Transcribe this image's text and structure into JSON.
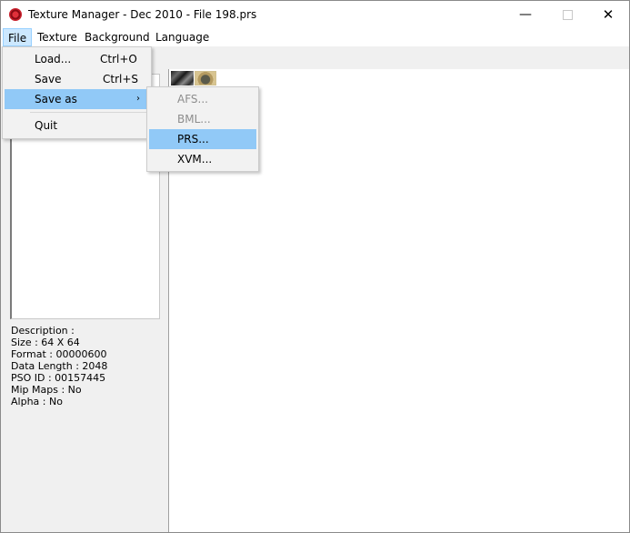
{
  "window": {
    "title": "Texture Manager - Dec 2010 - File 198.prs",
    "minimize": "—",
    "close": "✕"
  },
  "menubar": {
    "items": [
      {
        "label": "File"
      },
      {
        "label": "Texture"
      },
      {
        "label": "Background"
      },
      {
        "label": "Language"
      }
    ]
  },
  "file_menu": {
    "items": [
      {
        "label": "Load...",
        "shortcut": "Ctrl+O"
      },
      {
        "label": "Save",
        "shortcut": "Ctrl+S"
      },
      {
        "label": "Save as",
        "arrow": "›"
      },
      {
        "label": "Quit"
      }
    ]
  },
  "save_as_submenu": {
    "items": [
      {
        "label": "AFS...",
        "enabled": false
      },
      {
        "label": "BML...",
        "enabled": false
      },
      {
        "label": "PRS...",
        "enabled": true
      },
      {
        "label": "XVM...",
        "enabled": true
      }
    ]
  },
  "texture_info": {
    "description": "Description :",
    "size": "Size : 64 X 64",
    "format": "Format : 00000600",
    "data_length": "Data Length : 2048",
    "pso_id": "PSO ID : 00157445",
    "mip_maps": "Mip Maps : No",
    "alpha": "Alpha : No"
  },
  "colors": {
    "menu_highlight": "#91c9f7",
    "menubar_active": "#cce8ff",
    "panel_bg": "#f0f0f0",
    "disabled_text": "#8d8d8d"
  },
  "icons": {
    "app": "red-circle-app-icon",
    "submenu": "chevron-right-icon"
  }
}
